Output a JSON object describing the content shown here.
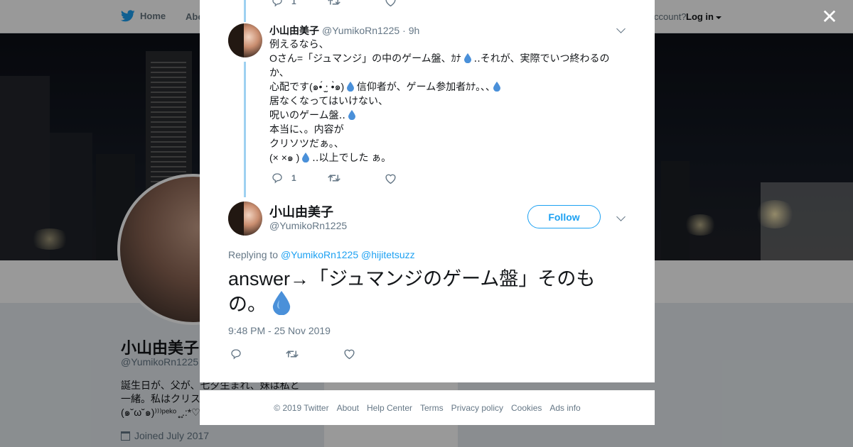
{
  "topbar": {
    "home_label": "Home",
    "about_label": "Abo",
    "have_account": "ccount?",
    "login_label": "Log in"
  },
  "profile_bg": {
    "name": "小山由美子",
    "handle": "@YumikoRn1225",
    "bio_line1": "誕生日が、父が、七夕生まれ、妹は私と",
    "bio_line2": "一緒。私はクリス",
    "bio_line3": "(๑˘ω˘๑)⁾⁾⁾ᵖᵉᵏᵒ ̥̥ ̥.:*♡",
    "joined": "Joined July 2017"
  },
  "thread": {
    "prev_reply_count": "1",
    "tweet1": {
      "name": "小山由美子",
      "handle": "@YumikoRn1225",
      "time": "· 9h",
      "lines": [
        "例えるなら、",
        "Oさん=「ジュマンジ」の中のゲーム盤、ｶﾅ",
        "‥それが、実際でいつ終わるの",
        "か、",
        "心配です(๑•́ ‧̫ •̀๑)",
        "信仰者が、ゲーム参加者ｶﾅ｡､､",
        "居なくなってはいけない、",
        "呪いのゲーム盤‥",
        "本当に、。内容が",
        "クリソツだぁ。、",
        "(× ×๑ )",
        "‥以上でした ぁ。"
      ],
      "reply_count": "1"
    },
    "main": {
      "name": "小山由美子",
      "handle": "@YumikoRn1225",
      "follow_label": "Follow",
      "replying_prefix": "Replying to",
      "replying_to_1": "@YumikoRn1225",
      "replying_to_2": "@hijitetsuzz",
      "text_part1": "answer→「ジュマンジのゲーム盤」そのも",
      "text_part2": "の。",
      "timestamp": "9:48 PM - 25 Nov 2019"
    }
  },
  "footer": {
    "copyright": "© 2019 Twitter",
    "about": "About",
    "help": "Help Center",
    "terms": "Terms",
    "privacy": "Privacy policy",
    "cookies": "Cookies",
    "ads": "Ads info"
  },
  "colors": {
    "accent": "#1da1f2",
    "thread_line": "#9ed1f1",
    "text": "#14171a",
    "muted": "#657786"
  },
  "icons": [
    "twitter-bird-icon",
    "close-icon",
    "reply-icon",
    "retweet-icon",
    "like-icon",
    "chevron-down-icon",
    "droplet-icon",
    "calendar-icon"
  ]
}
